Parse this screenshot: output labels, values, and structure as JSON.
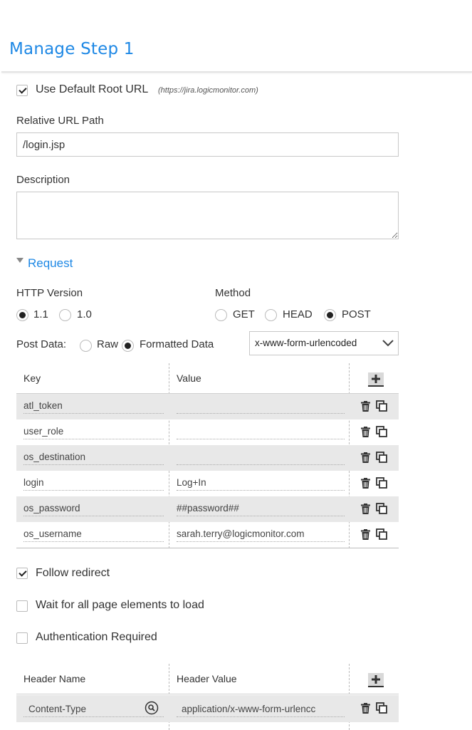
{
  "page_title": "Manage Step 1",
  "use_default_root": {
    "label": "Use Default Root URL",
    "hint": "(https://jira.logicmonitor.com)",
    "checked": true
  },
  "relative_url": {
    "label": "Relative URL Path",
    "value": "/login.jsp"
  },
  "description": {
    "label": "Description",
    "value": ""
  },
  "request_section": {
    "label": "Request"
  },
  "http_version": {
    "label": "HTTP Version",
    "options": [
      "1.1",
      "1.0"
    ],
    "selected": "1.1"
  },
  "method": {
    "label": "Method",
    "options": [
      "GET",
      "HEAD",
      "POST"
    ],
    "selected": "POST"
  },
  "post_data": {
    "label": "Post Data:",
    "options": [
      "Raw",
      "Formatted Data"
    ],
    "selected": "Formatted Data",
    "encoding": "x-www-form-urlencoded"
  },
  "params_table": {
    "headers": {
      "key": "Key",
      "value": "Value"
    },
    "rows": [
      {
        "key": "atl_token",
        "value": ""
      },
      {
        "key": "user_role",
        "value": ""
      },
      {
        "key": "os_destination",
        "value": ""
      },
      {
        "key": "login",
        "value": "Log+In"
      },
      {
        "key": "os_password",
        "value": "##password##"
      },
      {
        "key": "os_username",
        "value": "sarah.terry@logicmonitor.com"
      }
    ]
  },
  "follow_redirect": {
    "label": "Follow redirect",
    "checked": true
  },
  "wait_all_elements": {
    "label": "Wait for all page elements to load",
    "checked": false
  },
  "auth_required": {
    "label": "Authentication Required",
    "checked": false
  },
  "headers_table": {
    "headers": {
      "name": "Header Name",
      "value": "Header Value"
    },
    "rows": [
      {
        "name": "Content-Type",
        "value": "application/x-www-form-urlencc"
      }
    ]
  }
}
